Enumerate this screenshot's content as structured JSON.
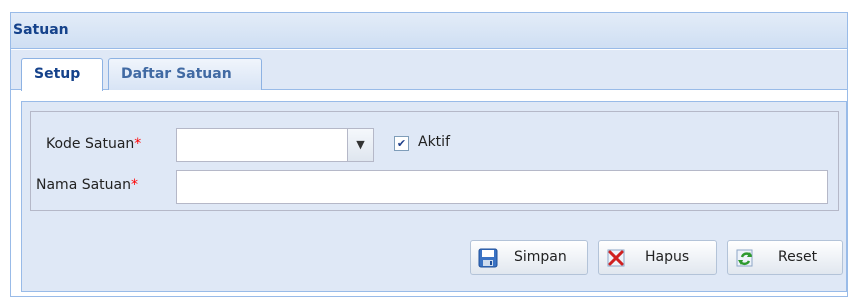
{
  "panel": {
    "title": "Satuan"
  },
  "tabs": [
    {
      "label": "Setup",
      "active": true
    },
    {
      "label": "Daftar Satuan",
      "active": false
    }
  ],
  "form": {
    "kode_label": "Kode Satuan",
    "kode_value": "",
    "nama_label": "Nama Satuan",
    "nama_value": "",
    "required_marker": "*",
    "aktif_label": "Aktif",
    "aktif_checked": true
  },
  "buttons": {
    "simpan": "Simpan",
    "hapus": "Hapus",
    "reset": "Reset"
  },
  "icons": {
    "combo_trigger": "chevron-down-icon",
    "simpan": "save-icon",
    "hapus": "delete-icon",
    "reset": "refresh-icon"
  },
  "colors": {
    "header_text": "#15428b",
    "border": "#99bbe8",
    "form_bg": "#dfe8f6",
    "required": "#ff0000"
  }
}
